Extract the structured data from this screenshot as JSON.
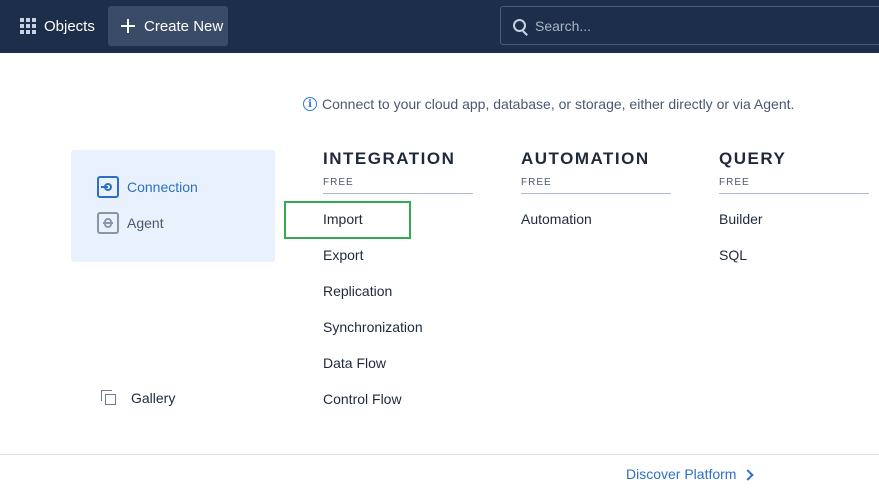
{
  "topbar": {
    "objects_label": "Objects",
    "create_new_label": "Create New",
    "search_placeholder": "Search..."
  },
  "info_text": "Connect to your cloud app, database, or storage, either directly or via Agent.",
  "left_panel": {
    "items": [
      {
        "label": "Connection",
        "icon": "connection-icon",
        "selected": true
      },
      {
        "label": "Agent",
        "icon": "agent-icon",
        "selected": false
      }
    ],
    "gallery_label": "Gallery"
  },
  "columns": {
    "integration": {
      "title": "INTEGRATION",
      "subtitle": "FREE",
      "items": [
        "Import",
        "Export",
        "Replication",
        "Synchronization",
        "Data Flow",
        "Control Flow"
      ]
    },
    "automation": {
      "title": "AUTOMATION",
      "subtitle": "FREE",
      "items": [
        "Automation"
      ]
    },
    "query": {
      "title": "QUERY",
      "subtitle": "FREE",
      "items": [
        "Builder",
        "SQL"
      ]
    }
  },
  "footer": {
    "discover_label": "Discover Platform"
  },
  "colors": {
    "topbar": "#1d2e4a",
    "accent": "#2d6fc7",
    "highlight_box": "#35a853"
  }
}
